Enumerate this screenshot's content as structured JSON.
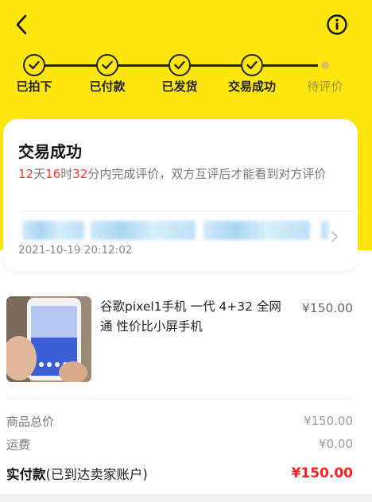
{
  "colors": {
    "accent_yellow": "#ffe60f",
    "price_red": "#ff1f1f",
    "countdown_red": "#ff3b30"
  },
  "nav": {
    "back_icon": "chevron-left-icon",
    "info_icon": "info-circle-icon"
  },
  "progress": {
    "steps": [
      {
        "label": "已拍下",
        "done": true
      },
      {
        "label": "已付款",
        "done": true
      },
      {
        "label": "已发货",
        "done": true
      },
      {
        "label": "交易成功",
        "done": true
      },
      {
        "label": "待评价",
        "done": false
      }
    ]
  },
  "status_card": {
    "title": "交易成功",
    "countdown": {
      "days": "12",
      "day_unit": "天",
      "hours": "16",
      "hour_unit": "时",
      "minutes": "32",
      "minute_unit": "分"
    },
    "message": "内完成评价，双方互评后才能看到对方评价",
    "time": "2021-10-19 20:12:02"
  },
  "product": {
    "title": "谷歌pixel1手机 一代 4+32 全网通 性价比小屏手机",
    "price": "¥150.00"
  },
  "summary": {
    "goods_total_label": "商品总价",
    "goods_total_value": "¥150.00",
    "shipping_label": "运费",
    "shipping_value": "¥0.00",
    "paid_label": "实付款",
    "paid_note": "(已到达卖家账户)",
    "paid_value": "¥150.00"
  }
}
